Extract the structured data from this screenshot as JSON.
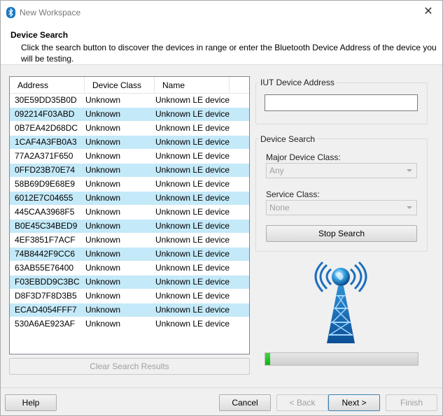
{
  "window": {
    "title": "New Workspace",
    "close_glyph": "✕",
    "icon": "bluetooth-icon"
  },
  "header": {
    "title": "Device Search",
    "description": "Click the search button to discover the devices in range or enter the Bluetooth Device Address of the device you will be testing."
  },
  "device_list": {
    "columns": [
      "Address",
      "Device Class",
      "Name"
    ],
    "rows": [
      [
        "30E59DD35B0D",
        "Unknown",
        "Unknown LE device"
      ],
      [
        "092214F03ABD",
        "Unknown",
        "Unknown LE device"
      ],
      [
        "0B7EA42D68DC",
        "Unknown",
        "Unknown LE device"
      ],
      [
        "1CAF4A3FB0A3",
        "Unknown",
        "Unknown LE device"
      ],
      [
        "77A2A371F650",
        "Unknown",
        "Unknown LE device"
      ],
      [
        "0FFD23B70E74",
        "Unknown",
        "Unknown LE device"
      ],
      [
        "58B69D9E68E9",
        "Unknown",
        "Unknown LE device"
      ],
      [
        "6012E7C04655",
        "Unknown",
        "Unknown LE device"
      ],
      [
        "445CAA3968F5",
        "Unknown",
        "Unknown LE device"
      ],
      [
        "B0E45C34BED9",
        "Unknown",
        "Unknown LE device"
      ],
      [
        "4EF3851F7ACF",
        "Unknown",
        "Unknown LE device"
      ],
      [
        "74B8442F9CC6",
        "Unknown",
        "Unknown LE device"
      ],
      [
        "63AB55E76400",
        "Unknown",
        "Unknown LE device"
      ],
      [
        "F03EBDD9C3BC",
        "Unknown",
        "Unknown LE device"
      ],
      [
        "D8F3D7F8D3B5",
        "Unknown",
        "Unknown LE device"
      ],
      [
        "ECAD4054FFF7",
        "Unknown",
        "Unknown LE device"
      ],
      [
        "530A6AE923AF",
        "Unknown",
        "Unknown LE device"
      ]
    ],
    "clear_button": "Clear Search Results"
  },
  "iut": {
    "label": "IUT Device Address",
    "value": ""
  },
  "search": {
    "label": "Device Search",
    "major_class_label": "Major Device Class:",
    "major_class_value": "Any",
    "service_class_label": "Service Class:",
    "service_class_value": "None",
    "stop_button": "Stop Search"
  },
  "progress": {
    "value": 0.03,
    "color": "#1cc21c"
  },
  "footer": {
    "help": "Help",
    "cancel": "Cancel",
    "back": "< Back",
    "next": "Next >",
    "finish": "Finish"
  },
  "colors": {
    "row_alt": "#c4e9f8",
    "accent": "#1a78c2"
  }
}
